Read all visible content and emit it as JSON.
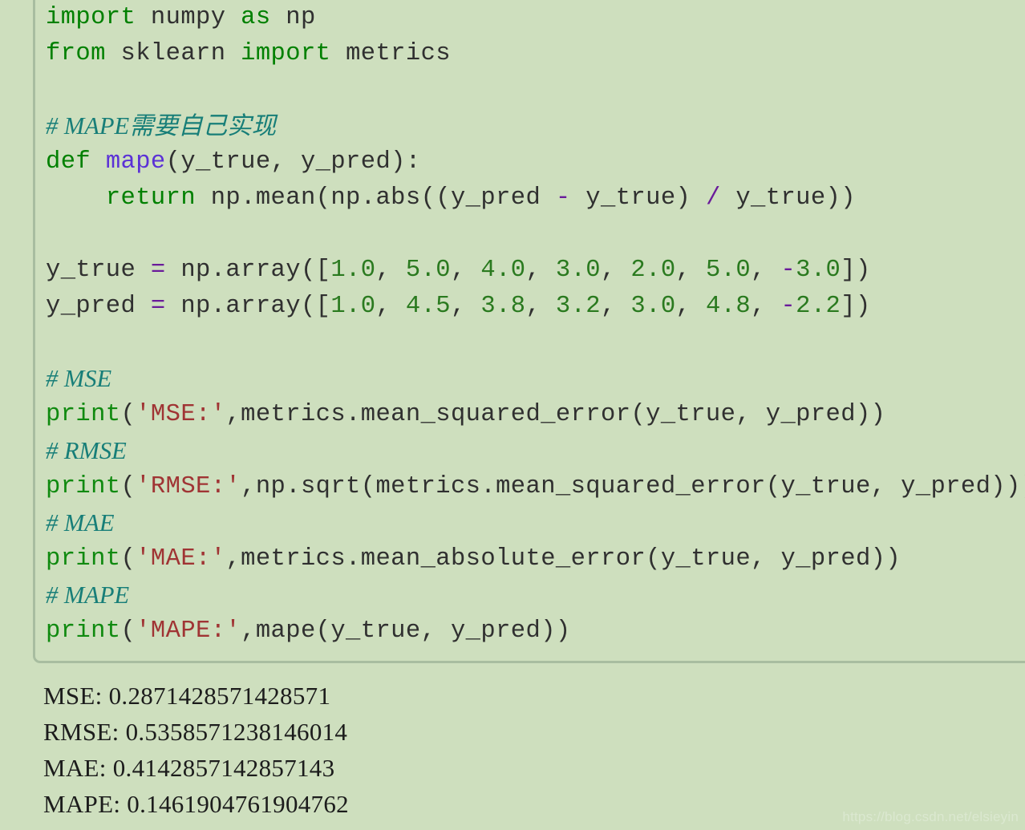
{
  "theme": {
    "page_background": "#cedfbe",
    "code_background": "#cedfbe",
    "border_color": "#a8bda0",
    "keyword_color": "#008000",
    "builtin_color": "#108a10",
    "function_color": "#5b31d6",
    "number_color": "#2a7a1f",
    "string_color": "#a03434",
    "operator_color": "#6a1b9a",
    "comment_color": "#177e78",
    "identifier_color": "#303030",
    "output_text_color": "#1c1c1c",
    "watermark_color": "#dbe8d0"
  },
  "code": {
    "language": "python",
    "lines": [
      {
        "index": 1,
        "text": "import numpy as np"
      },
      {
        "index": 2,
        "text": "from sklearn import metrics"
      },
      {
        "index": 3,
        "text": ""
      },
      {
        "index": 4,
        "text": "# MAPE需要自己实现"
      },
      {
        "index": 5,
        "text": "def mape(y_true, y_pred):"
      },
      {
        "index": 6,
        "text": "    return np.mean(np.abs((y_pred - y_true) / y_true))"
      },
      {
        "index": 7,
        "text": ""
      },
      {
        "index": 8,
        "text": "y_true = np.array([1.0, 5.0, 4.0, 3.0, 2.0, 5.0, -3.0])"
      },
      {
        "index": 9,
        "text": "y_pred = np.array([1.0, 4.5, 3.8, 3.2, 3.0, 4.8, -2.2])"
      },
      {
        "index": 10,
        "text": ""
      },
      {
        "index": 11,
        "text": "# MSE"
      },
      {
        "index": 12,
        "text": "print('MSE:',metrics.mean_squared_error(y_true, y_pred))"
      },
      {
        "index": 13,
        "text": "# RMSE"
      },
      {
        "index": 14,
        "text": "print('RMSE:',np.sqrt(metrics.mean_squared_error(y_true, y_pred)))"
      },
      {
        "index": 15,
        "text": "# MAE"
      },
      {
        "index": 16,
        "text": "print('MAE:',metrics.mean_absolute_error(y_true, y_pred))"
      },
      {
        "index": 17,
        "text": "# MAPE"
      },
      {
        "index": 18,
        "text": "print('MAPE:',mape(y_true, y_pred))"
      }
    ],
    "tokens": [
      [
        {
          "t": "import",
          "c": "kw"
        },
        {
          "t": " ",
          "c": "id"
        },
        {
          "t": "numpy",
          "c": "id"
        },
        {
          "t": " ",
          "c": "id"
        },
        {
          "t": "as",
          "c": "kw"
        },
        {
          "t": " ",
          "c": "id"
        },
        {
          "t": "np",
          "c": "id"
        }
      ],
      [
        {
          "t": "from",
          "c": "kw"
        },
        {
          "t": " ",
          "c": "id"
        },
        {
          "t": "sklearn",
          "c": "id"
        },
        {
          "t": " ",
          "c": "id"
        },
        {
          "t": "import",
          "c": "kw"
        },
        {
          "t": " ",
          "c": "id"
        },
        {
          "t": "metrics",
          "c": "id"
        }
      ],
      [
        {
          "t": " ",
          "c": "id"
        }
      ],
      [
        {
          "t": "# MAPE需要自己实现",
          "c": "cm"
        }
      ],
      [
        {
          "t": "def",
          "c": "kw"
        },
        {
          "t": " ",
          "c": "id"
        },
        {
          "t": "mape",
          "c": "fn"
        },
        {
          "t": "(y_true, y_pred):",
          "c": "id"
        }
      ],
      [
        {
          "t": "    ",
          "c": "id"
        },
        {
          "t": "return",
          "c": "kw"
        },
        {
          "t": " np.mean(np.abs((y_pred ",
          "c": "id"
        },
        {
          "t": "-",
          "c": "op"
        },
        {
          "t": " y_true) ",
          "c": "id"
        },
        {
          "t": "/",
          "c": "op"
        },
        {
          "t": " y_true))",
          "c": "id"
        }
      ],
      [
        {
          "t": " ",
          "c": "id"
        }
      ],
      [
        {
          "t": "y_true ",
          "c": "id"
        },
        {
          "t": "=",
          "c": "op"
        },
        {
          "t": " np.array([",
          "c": "id"
        },
        {
          "t": "1.0",
          "c": "num"
        },
        {
          "t": ", ",
          "c": "id"
        },
        {
          "t": "5.0",
          "c": "num"
        },
        {
          "t": ", ",
          "c": "id"
        },
        {
          "t": "4.0",
          "c": "num"
        },
        {
          "t": ", ",
          "c": "id"
        },
        {
          "t": "3.0",
          "c": "num"
        },
        {
          "t": ", ",
          "c": "id"
        },
        {
          "t": "2.0",
          "c": "num"
        },
        {
          "t": ", ",
          "c": "id"
        },
        {
          "t": "5.0",
          "c": "num"
        },
        {
          "t": ", ",
          "c": "id"
        },
        {
          "t": "-",
          "c": "op"
        },
        {
          "t": "3.0",
          "c": "num"
        },
        {
          "t": "])",
          "c": "id"
        }
      ],
      [
        {
          "t": "y_pred ",
          "c": "id"
        },
        {
          "t": "=",
          "c": "op"
        },
        {
          "t": " np.array([",
          "c": "id"
        },
        {
          "t": "1.0",
          "c": "num"
        },
        {
          "t": ", ",
          "c": "id"
        },
        {
          "t": "4.5",
          "c": "num"
        },
        {
          "t": ", ",
          "c": "id"
        },
        {
          "t": "3.8",
          "c": "num"
        },
        {
          "t": ", ",
          "c": "id"
        },
        {
          "t": "3.2",
          "c": "num"
        },
        {
          "t": ", ",
          "c": "id"
        },
        {
          "t": "3.0",
          "c": "num"
        },
        {
          "t": ", ",
          "c": "id"
        },
        {
          "t": "4.8",
          "c": "num"
        },
        {
          "t": ", ",
          "c": "id"
        },
        {
          "t": "-",
          "c": "op"
        },
        {
          "t": "2.2",
          "c": "num"
        },
        {
          "t": "])",
          "c": "id"
        }
      ],
      [
        {
          "t": " ",
          "c": "id"
        }
      ],
      [
        {
          "t": "# MSE",
          "c": "cm"
        }
      ],
      [
        {
          "t": "print",
          "c": "bi"
        },
        {
          "t": "(",
          "c": "id"
        },
        {
          "t": "'MSE:'",
          "c": "str"
        },
        {
          "t": ",metrics.mean_squared_error(y_true, y_pred))",
          "c": "id"
        }
      ],
      [
        {
          "t": "# RMSE",
          "c": "cm"
        }
      ],
      [
        {
          "t": "print",
          "c": "bi"
        },
        {
          "t": "(",
          "c": "id"
        },
        {
          "t": "'RMSE:'",
          "c": "str"
        },
        {
          "t": ",np.sqrt(metrics.mean_squared_error(y_true, y_pred)))",
          "c": "id"
        }
      ],
      [
        {
          "t": "# MAE",
          "c": "cm"
        }
      ],
      [
        {
          "t": "print",
          "c": "bi"
        },
        {
          "t": "(",
          "c": "id"
        },
        {
          "t": "'MAE:'",
          "c": "str"
        },
        {
          "t": ",metrics.mean_absolute_error(y_true, y_pred))",
          "c": "id"
        }
      ],
      [
        {
          "t": "# MAPE",
          "c": "cm"
        }
      ],
      [
        {
          "t": "print",
          "c": "bi"
        },
        {
          "t": "(",
          "c": "id"
        },
        {
          "t": "'MAPE:'",
          "c": "str"
        },
        {
          "t": ",mape(y_true, y_pred))",
          "c": "id"
        }
      ]
    ]
  },
  "output": {
    "lines": [
      {
        "label": "MSE:",
        "value": "0.2871428571428571",
        "text": "MSE: 0.2871428571428571"
      },
      {
        "label": "RMSE:",
        "value": "0.5358571238146014",
        "text": "RMSE: 0.5358571238146014"
      },
      {
        "label": "MAE:",
        "value": "0.4142857142857143",
        "text": "MAE: 0.4142857142857143"
      },
      {
        "label": "MAPE:",
        "value": "0.1461904761904762",
        "text": "MAPE: 0.1461904761904762"
      }
    ]
  },
  "watermark": {
    "text": "https://blog.csdn.net/elsieyin"
  }
}
